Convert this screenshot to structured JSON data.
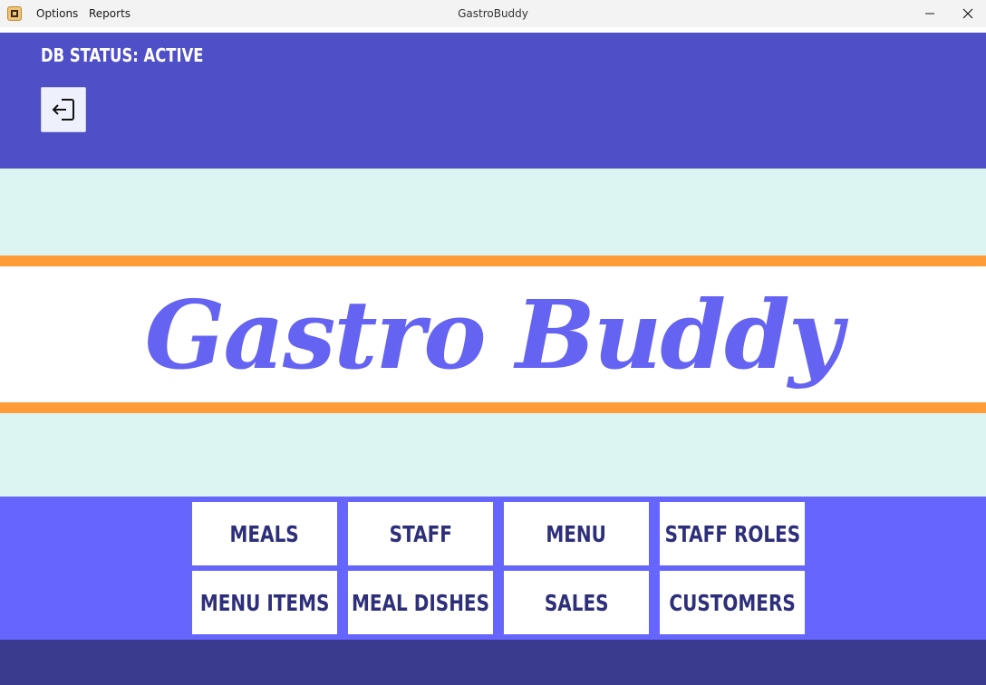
{
  "window": {
    "title": "GastroBuddy",
    "menu": [
      "Options",
      "Reports"
    ]
  },
  "header": {
    "db_status": "DB STATUS: ACTIVE"
  },
  "logo": {
    "text": "Gastro Buddy"
  },
  "nav": {
    "buttons": [
      {
        "label": "MEALS"
      },
      {
        "label": "STAFF"
      },
      {
        "label": "MENU"
      },
      {
        "label": "STAFF ROLES"
      },
      {
        "label": "MENU ITEMS"
      },
      {
        "label": "MEAL DISHES"
      },
      {
        "label": "SALES"
      },
      {
        "label": "CUSTOMERS"
      }
    ]
  },
  "icons": {
    "app": "app-icon",
    "logout": "logout-icon",
    "minimize": "minimize-icon",
    "close": "close-icon"
  },
  "colors": {
    "header": "#4f50c8",
    "mint": "#dcf5f2",
    "stripe": "#ff9c38",
    "logo": "#6563f2",
    "nav_band": "#6666ff",
    "nav_text": "#2e2f7a",
    "footer": "#3a3a8e"
  }
}
